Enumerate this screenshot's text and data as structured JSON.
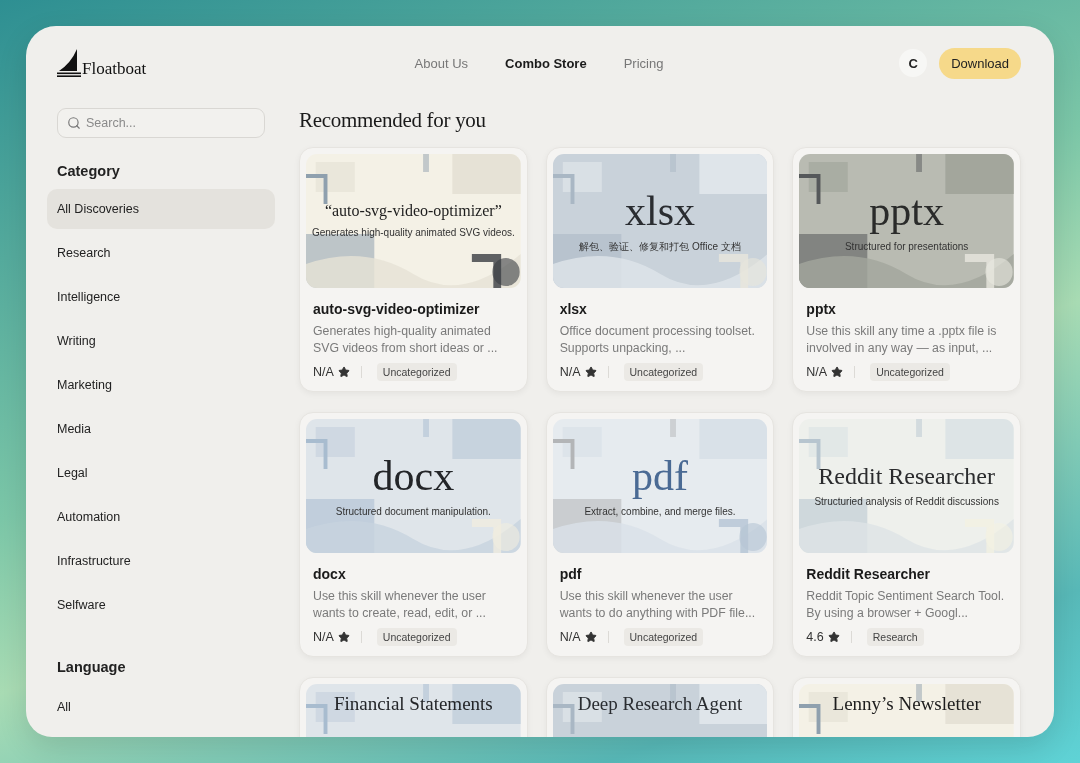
{
  "brand": {
    "name": "Floatboat"
  },
  "nav": [
    {
      "label": "About Us",
      "selected": false
    },
    {
      "label": "Combo Store",
      "selected": true
    },
    {
      "label": "Pricing",
      "selected": false
    }
  ],
  "account": {
    "avatar": "C",
    "download": "Download"
  },
  "sidebar": {
    "search": {
      "placeholder": "Search..."
    },
    "sections": [
      {
        "title": "Category",
        "items": [
          {
            "label": "All Discoveries",
            "selected": true
          },
          {
            "label": "Research",
            "selected": false
          },
          {
            "label": "Intelligence",
            "selected": false
          },
          {
            "label": "Writing",
            "selected": false
          },
          {
            "label": "Marketing",
            "selected": false
          },
          {
            "label": "Media",
            "selected": false
          },
          {
            "label": "Legal",
            "selected": false
          },
          {
            "label": "Automation",
            "selected": false
          },
          {
            "label": "Infrastructure",
            "selected": false
          },
          {
            "label": "Selfware",
            "selected": false
          }
        ]
      },
      {
        "title": "Language",
        "items": [
          {
            "label": "All",
            "selected": false
          }
        ]
      }
    ]
  },
  "main": {
    "heading": "Recommended for you",
    "cards": [
      {
        "cover": {
          "kind": "cream",
          "title": "“auto-svg-video-optimizer”",
          "subtitle": "Generates high-quality animated SVG videos."
        },
        "title": "auto-svg-video-optimizer",
        "description": "Generates high-quality animated SVG videos from short ideas or ...",
        "rating": "N/A",
        "tag": "Uncategorized"
      },
      {
        "cover": {
          "kind": "slate",
          "title": "xlsx",
          "subtitle": "解包、验证、修复和打包 Office 文档"
        },
        "title": "xlsx",
        "description": "Office document processing toolset. Supports unpacking, ...",
        "rating": "N/A",
        "tag": "Uncategorized"
      },
      {
        "cover": {
          "kind": "sage",
          "title": "pptx",
          "subtitle": "Structured for presentations"
        },
        "title": "pptx",
        "description": "Use this skill any time a .pptx file is involved in any way — as input, ...",
        "rating": "N/A",
        "tag": "Uncategorized"
      },
      {
        "cover": {
          "kind": "blue",
          "title": "docx",
          "subtitle": "Structured document manipulation."
        },
        "title": "docx",
        "description": "Use this skill whenever the user wants to create, read, edit, or ...",
        "rating": "N/A",
        "tag": "Uncategorized"
      },
      {
        "cover": {
          "kind": "mist",
          "title": "pdf",
          "subtitle": "Extract, combine, and merge files."
        },
        "title": "pdf",
        "description": "Use this skill whenever the user wants to do anything with PDF file...",
        "rating": "N/A",
        "tag": "Uncategorized"
      },
      {
        "cover": {
          "kind": "pale",
          "title": "Reddit Researcher",
          "subtitle": "Structuried analysis of Reddit discussions"
        },
        "title": "Reddit Researcher",
        "description": "Reddit Topic Sentiment Search Tool. By using a browser + Googl...",
        "rating": "4.6",
        "tag": "Research"
      },
      {
        "cover": {
          "kind": "blue",
          "title": "Financial Statements"
        }
      },
      {
        "cover": {
          "kind": "slate",
          "title": "Deep Research Agent"
        }
      },
      {
        "cover": {
          "kind": "cream",
          "title": "Lenny’s Newsletter"
        }
      }
    ]
  }
}
